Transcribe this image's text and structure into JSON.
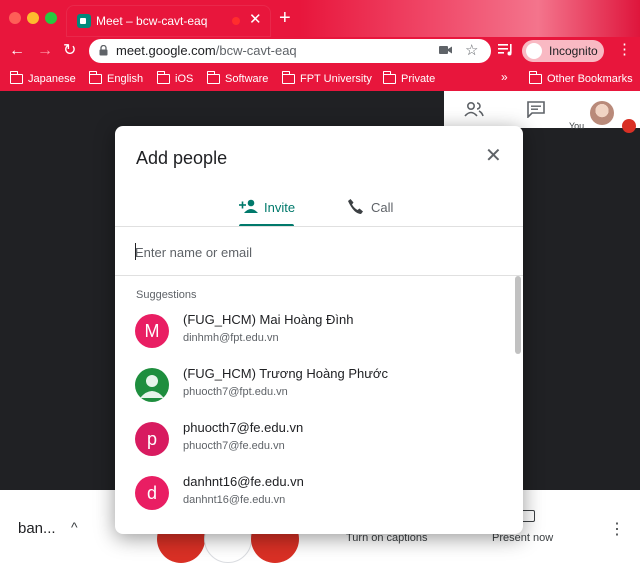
{
  "browser": {
    "tab_title": "Meet – bcw-cavt-eaq",
    "tab_close": "✕",
    "new_tab": "+",
    "url_host": "meet.google.com",
    "url_path": "/bcw-cavt-eaq",
    "incognito_label": "Incognito",
    "back_glyph": "←",
    "forward_glyph": "→",
    "reload_glyph": "↻",
    "star_glyph": "☆",
    "menu_glyph": "⋮",
    "bookmarks": [
      "Japanese",
      "English",
      "iOS",
      "Software",
      "FPT University",
      "Private"
    ],
    "bookmarks_more": "»",
    "other_bookmarks": "Other Bookmarks",
    "accent_color": "#e8163c"
  },
  "meet": {
    "you_label": "You",
    "meeting_name": "ban...",
    "caret": "^",
    "captions_label": "Turn on captions",
    "present_label": "Present now",
    "more_glyph": "⋮"
  },
  "dialog": {
    "title": "Add people",
    "close_glyph": "✕",
    "tabs": {
      "invite": "Invite",
      "call": "Call"
    },
    "search_placeholder": "Enter name or email",
    "suggestions_heading": "Suggestions",
    "suggestions": [
      {
        "avatar": "M",
        "color": "#e91e63",
        "name": "(FUG_HCM) Mai Hoàng Đình",
        "email": "dinhmh@fpt.edu.vn"
      },
      {
        "avatar": "person-icon",
        "color": "#1e8e3e",
        "name": "(FUG_HCM) Trương Hoàng Phước",
        "email": "phuocth7@fpt.edu.vn"
      },
      {
        "avatar": "p",
        "color": "#d81b60",
        "name": "phuocth7@fe.edu.vn",
        "email": "phuocth7@fe.edu.vn"
      },
      {
        "avatar": "d",
        "color": "#e91e63",
        "name": "danhnt16@fe.edu.vn",
        "email": "danhnt16@fe.edu.vn"
      }
    ]
  }
}
